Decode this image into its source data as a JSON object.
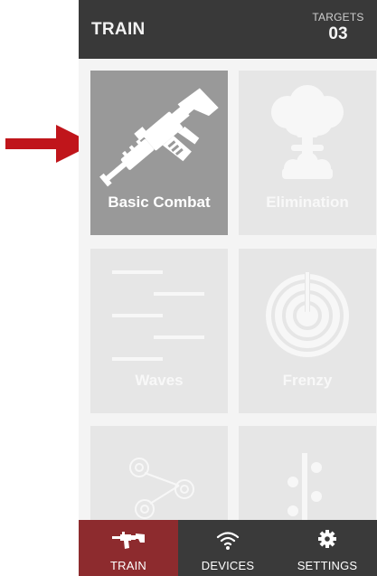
{
  "header": {
    "title": "TRAIN",
    "targets_label": "TARGETS",
    "targets_count": "03"
  },
  "modes": [
    {
      "label": "Basic Combat",
      "icon": "rifle-icon",
      "selected": true
    },
    {
      "label": "Elimination",
      "icon": "mushroom-cloud-icon",
      "selected": false
    },
    {
      "label": "Waves",
      "icon": "waves-icon",
      "selected": false
    },
    {
      "label": "Frenzy",
      "icon": "radar-icon",
      "selected": false
    },
    {
      "label": "",
      "icon": "target-network-icon",
      "selected": false
    },
    {
      "label": "",
      "icon": "sequence-icon",
      "selected": false
    }
  ],
  "tabs": [
    {
      "label": "TRAIN",
      "icon": "rifle-icon",
      "active": true
    },
    {
      "label": "DEVICES",
      "icon": "wifi-icon",
      "active": false
    },
    {
      "label": "SETTINGS",
      "icon": "gear-icon",
      "active": false
    }
  ],
  "annotation": {
    "icon": "arrow-right-icon",
    "color": "#c0151b"
  },
  "colors": {
    "header_bg": "#393939",
    "tile_bg": "#e6e6e6",
    "tile_selected_bg": "#999999",
    "tabbar_bg": "#3a3a3a",
    "tab_active_bg": "#8d2b2e"
  }
}
